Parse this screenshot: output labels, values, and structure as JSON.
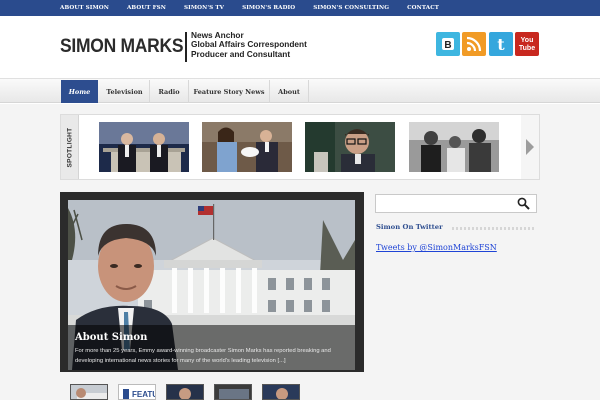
{
  "top_nav": [
    "ABOUT SIMON",
    "ABOUT FSN",
    "SIMON'S TV",
    "SIMON'S RADIO",
    "SIMON'S CONSULTING",
    "CONTACT"
  ],
  "header": {
    "name": "SIMON MARKS",
    "tagline": [
      "News Anchor",
      "Global Affairs Correspondent",
      "Producer and Consultant"
    ],
    "social": [
      {
        "name": "blogger",
        "glyph": "B",
        "color": "#3eb6e0"
      },
      {
        "name": "rss",
        "color": "#f19b26"
      },
      {
        "name": "twitter",
        "glyph": "t",
        "color": "#35a7dd"
      },
      {
        "name": "youtube",
        "glyph": "You Tube",
        "color": "#c8281f"
      }
    ]
  },
  "main_nav": [
    "Home",
    "Television",
    "Radio",
    "Feature Story News",
    "About"
  ],
  "spotlight": {
    "label": "SPOTLIGHT",
    "thumbnails": [
      "leaders at podium",
      "royal couple with baby",
      "man in glasses",
      "black and white photo"
    ]
  },
  "feature": {
    "title": "About Simon",
    "text": "For more than 25 years, Emmy award-winning broadcaster Simon Marks has reported breaking and developing international news stories for many of the world's leading television [...]",
    "thumb_text": "FEATU STO"
  },
  "sidebar": {
    "search_placeholder": "",
    "heading": "Simon On Twitter",
    "tweets_link": "Tweets by @SimonMarksFSN"
  },
  "colors": {
    "accent": "#2d4d8f",
    "topbar": "#2a4b8d",
    "link": "#1f44d6"
  }
}
